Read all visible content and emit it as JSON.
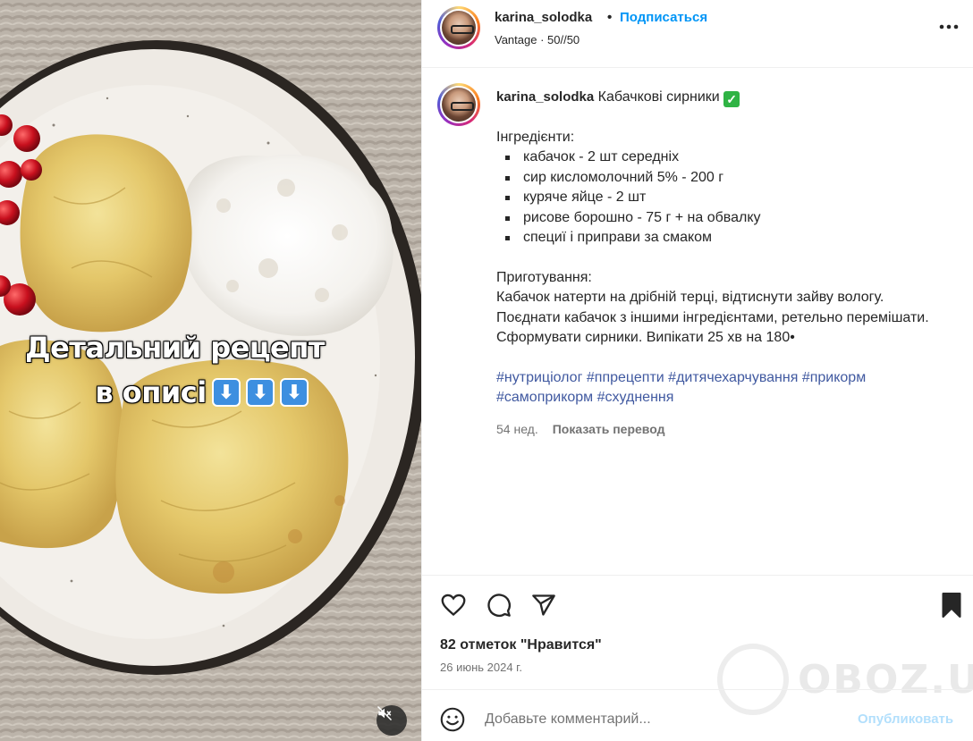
{
  "post": {
    "username": "karina_solodka",
    "separator": "•",
    "follow_label": "Подписаться",
    "audio": "Vantage · 50//50"
  },
  "media": {
    "overlay_line1": "Детальний рецепт",
    "overlay_line2": "в описі",
    "overlay_arrows": [
      "⬇",
      "⬇",
      "⬇"
    ],
    "mute_icon": "speaker-muted-icon"
  },
  "caption": {
    "username": "karina_solodka",
    "title": "Кабачкові сирники",
    "check": "✓",
    "ingredients_heading": "Інгредієнти:",
    "ingredients": [
      "кабачок - 2 шт середніх",
      "сир кисломолочний 5% - 200 г",
      "куряче яйце - 2 шт",
      "рисове борошно - 75 г + на обвалку",
      "специї і приправи за смаком"
    ],
    "method_heading": "Приготування:",
    "method_text": "Кабачок натерти на дрібній терці, відтиснути зайву вологу. Поєднати кабачок з іншими інгредієнтами, ретельно перемішати. Сформувати сирники. Випікати 25 хв на 180•",
    "hashtags": [
      "#нутриціолог",
      "#ппрецепти",
      "#дитячехарчування",
      "#прикорм",
      "#самоприкорм",
      "#схуднення"
    ],
    "age": "54 нед.",
    "translate_label": "Показать перевод"
  },
  "actions": {
    "likes": "82 отметок \"Нравится\"",
    "date": "26 июнь 2024 г."
  },
  "comment": {
    "placeholder": "Добавьте комментарий...",
    "post_label": "Опубликовать"
  },
  "watermark": "OBOZ.UA",
  "colors": {
    "accent": "#0095f6",
    "hashtag": "#4059a0",
    "post_disabled": "#b2dffc",
    "check_green": "#2fb344"
  }
}
